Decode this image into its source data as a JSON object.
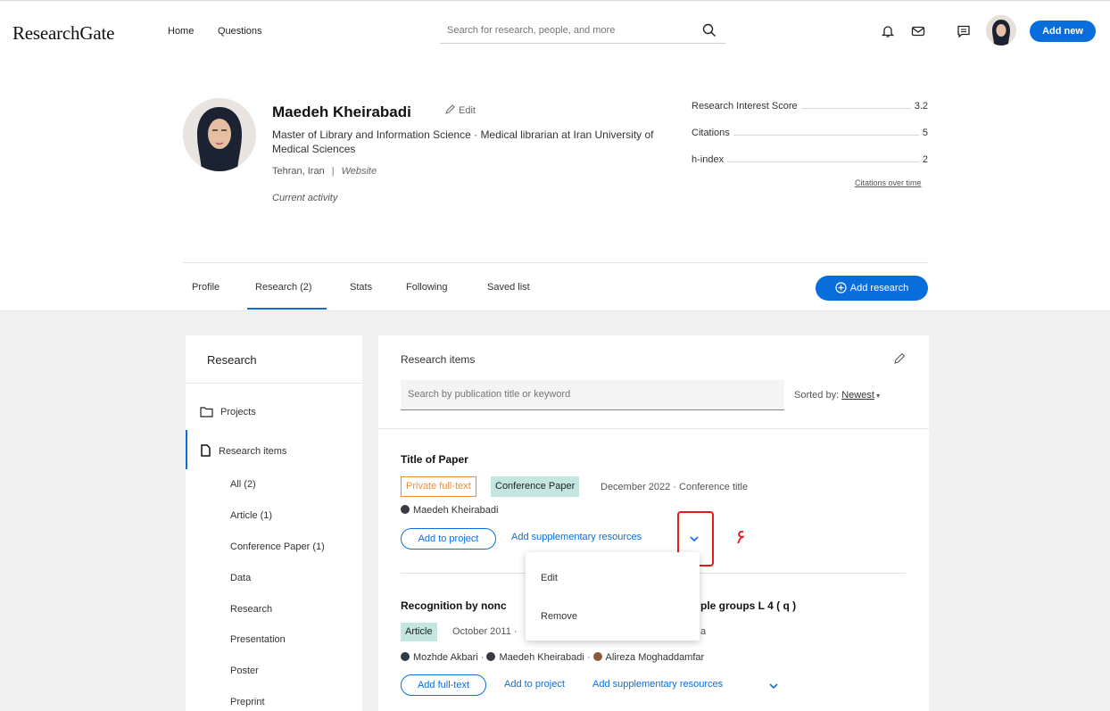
{
  "header": {
    "logo": "ResearchGate",
    "nav": [
      "Home",
      "Questions"
    ],
    "search_placeholder": "Search for research, people, and more",
    "add_new": "Add new"
  },
  "profile": {
    "name": "Maedeh Kheirabadi",
    "edit": "Edit",
    "description": "Master of Library and Information Science · Medical librarian at Iran University of Medical Sciences",
    "location": "Tehran, Iran",
    "website": "Website",
    "current_activity": "Current activity",
    "metrics": [
      {
        "label": "Research Interest Score",
        "value": "3.2"
      },
      {
        "label": "Citations",
        "value": "5"
      },
      {
        "label": "h-index",
        "value": "2"
      }
    ],
    "citations_over_time": "Citations over time"
  },
  "tabs": {
    "items": [
      "Profile",
      "Research (2)",
      "Stats",
      "Following",
      "Saved list"
    ],
    "active": "Research (2)",
    "add_research": "Add research"
  },
  "sidebar": {
    "title": "Research",
    "projects": "Projects",
    "research_items": "Research items",
    "subitems": [
      "All (2)",
      "Article (1)",
      "Conference Paper (1)",
      "Data",
      "Research",
      "Presentation",
      "Poster",
      "Preprint"
    ]
  },
  "main": {
    "title": "Research items",
    "search_placeholder": "Search by publication title or keyword",
    "sorted_label": "Sorted by:",
    "sorted_value": "Newest",
    "items": [
      {
        "title": "Title of Paper",
        "badge_private": "Private full-text",
        "badge_type": "Conference Paper",
        "meta": "December 2022 · Conference title",
        "author": "Maedeh Kheirabadi",
        "btn_add_project": "Add to project",
        "link_supplementary": "Add supplementary resources"
      },
      {
        "title_start": "Recognition by nonc",
        "title_end": "ple groups L 4 ( q )",
        "badge_type": "Article",
        "meta": "October 2011 ·",
        "meta_end": "a",
        "authors": [
          "Mozhde Akbari",
          "Maedeh Kheirabadi",
          "Alireza Moghaddamfar"
        ],
        "btn_add_fulltext": "Add full-text",
        "link_add_project": "Add to project",
        "link_supplementary": "Add supplementary resources"
      }
    ]
  },
  "annotation": "۶",
  "dropdown": {
    "items": [
      "Edit",
      "Remove"
    ]
  },
  "colors": {
    "accent": "#0a6ddc",
    "private_badge": "#e8903a",
    "type_badge": "#c4e6e0",
    "annotation": "#e21b1b"
  }
}
